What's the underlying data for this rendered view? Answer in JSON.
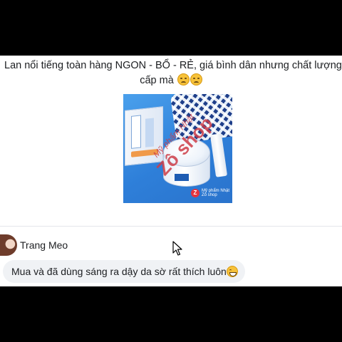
{
  "post": {
    "text_line1": "Lan nổi tiếng toàn hàng NGON - BỔ - RẺ, giá bình dân nhưng chất lượng c",
    "text_line2": "cấp mà",
    "emojis": [
      "weary-face-icon",
      "weary-face-icon"
    ]
  },
  "image": {
    "watermark_line1": "Mỹ phẩm Nhật",
    "watermark_line2": "Zô shop",
    "badge_letter": "Z",
    "badge_text1": "Mỹ phẩm Nhật",
    "badge_text2": "Zô shop"
  },
  "comment": {
    "author": "Trang Meo",
    "text": "Mua và đã dùng sáng ra dậy da sờ rất thích luôn",
    "emoji": "grinning-face-icon"
  },
  "colors": {
    "bubble_bg": "#f0f2f5",
    "text": "#1c1e21",
    "letterbox": "#000000",
    "watermark": "#cd3c46"
  }
}
